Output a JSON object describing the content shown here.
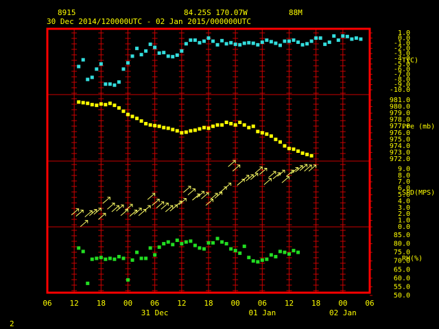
{
  "header": {
    "station_id": "8915",
    "location": "84.25S  170.07W",
    "elevation": "88M",
    "time_range": "30 Dec 2014/120000UTC - 02 Jan 2015/000000UTC"
  },
  "page_number": "2",
  "colors": {
    "frame": "#ff0000",
    "grid": "#cc0000",
    "text": "#ffff00",
    "temperature": "#33dddd",
    "pressure": "#ffff00",
    "wind": "#ffff66",
    "rh": "#22dd22"
  },
  "chart_data": {
    "type": "scatter",
    "title": "",
    "x_axis": {
      "unit": "hours since 30 Dec 2014 06 UTC",
      "range": [
        0,
        72
      ],
      "ticks": [
        0,
        6,
        12,
        18,
        24,
        30,
        36,
        42,
        48,
        54,
        60,
        66,
        72
      ],
      "tick_labels": [
        "06",
        "12",
        "18",
        "00",
        "06",
        "12",
        "18",
        "00",
        "06",
        "12",
        "18",
        "00",
        "06"
      ],
      "day_labels": [
        {
          "x": 24,
          "label": "31 Dec"
        },
        {
          "x": 48,
          "label": "01 Jan"
        },
        {
          "x": 66,
          "label": "02 Jan"
        }
      ]
    },
    "panels": [
      {
        "name": "temperature",
        "label": "T(C)",
        "ylim": [
          -10,
          1
        ],
        "ticks": [
          "1.0",
          "0.0",
          "-1.0",
          "-2.0",
          "-3.0",
          "-4.0",
          "-5.0",
          "-6.0",
          "-7.0",
          "-8.0",
          "-9.0",
          "-10.0"
        ],
        "points": [
          [
            7,
            -5.5
          ],
          [
            8,
            -4.2
          ],
          [
            9,
            -8.0
          ],
          [
            10,
            -7.6
          ],
          [
            11,
            -6.0
          ],
          [
            12,
            -5.0
          ],
          [
            13,
            -8.9
          ],
          [
            14,
            -8.9
          ],
          [
            15,
            -9.1
          ],
          [
            16,
            -8.5
          ],
          [
            17,
            -6.0
          ],
          [
            18,
            -4.8
          ],
          [
            19,
            -3.5
          ],
          [
            20,
            -2.0
          ],
          [
            21,
            -3.2
          ],
          [
            22,
            -2.5
          ],
          [
            23,
            -1.2
          ],
          [
            24,
            -1.8
          ],
          [
            25,
            -2.9
          ],
          [
            26,
            -2.8
          ],
          [
            27,
            -3.5
          ],
          [
            28,
            -3.6
          ],
          [
            29,
            -3.3
          ],
          [
            30,
            -2.5
          ],
          [
            31,
            -1.1
          ],
          [
            32,
            -0.4
          ],
          [
            33,
            -0.4
          ],
          [
            34,
            -0.9
          ],
          [
            35,
            -0.6
          ],
          [
            36,
            0.0
          ],
          [
            37,
            -0.6
          ],
          [
            38,
            -1.3
          ],
          [
            39,
            -0.5
          ],
          [
            40,
            -1.1
          ],
          [
            41,
            -0.9
          ],
          [
            42,
            -1.2
          ],
          [
            43,
            -1.3
          ],
          [
            44,
            -1.0
          ],
          [
            45,
            -0.9
          ],
          [
            46,
            -1.0
          ],
          [
            47,
            -1.3
          ],
          [
            48,
            -0.8
          ],
          [
            49,
            -0.4
          ],
          [
            50,
            -0.7
          ],
          [
            51,
            -1.0
          ],
          [
            52,
            -1.4
          ],
          [
            53,
            -0.6
          ],
          [
            54,
            -0.6
          ],
          [
            55,
            -0.4
          ],
          [
            56,
            -0.8
          ],
          [
            57,
            -1.3
          ],
          [
            58,
            -1.1
          ],
          [
            59,
            -0.6
          ],
          [
            60,
            0.0
          ],
          [
            61,
            0.0
          ],
          [
            62,
            -1.2
          ],
          [
            63,
            -0.8
          ],
          [
            64,
            0.4
          ],
          [
            65,
            -0.4
          ],
          [
            66,
            0.4
          ],
          [
            67,
            0.3
          ],
          [
            68,
            -0.2
          ],
          [
            69,
            0.0
          ],
          [
            70,
            -0.2
          ]
        ]
      },
      {
        "name": "pressure",
        "label": "Pre (mb)",
        "ylim": [
          972,
          981
        ],
        "ticks": [
          "981.0",
          "980.0",
          "979.0",
          "978.0",
          "977.0",
          "976.0",
          "975.0",
          "974.0",
          "973.0",
          "972.0"
        ],
        "points": [
          [
            7,
            980.7
          ],
          [
            8,
            980.6
          ],
          [
            9,
            980.5
          ],
          [
            10,
            980.3
          ],
          [
            11,
            980.2
          ],
          [
            12,
            980.4
          ],
          [
            13,
            980.3
          ],
          [
            14,
            980.5
          ],
          [
            15,
            980.2
          ],
          [
            16,
            979.8
          ],
          [
            17,
            979.3
          ],
          [
            18,
            978.8
          ],
          [
            19,
            978.5
          ],
          [
            20,
            978.2
          ],
          [
            21,
            977.8
          ],
          [
            22,
            977.4
          ],
          [
            23,
            977.2
          ],
          [
            24,
            977.1
          ],
          [
            25,
            977.0
          ],
          [
            26,
            976.8
          ],
          [
            27,
            976.7
          ],
          [
            28,
            976.5
          ],
          [
            29,
            976.3
          ],
          [
            30,
            976.0
          ],
          [
            31,
            976.1
          ],
          [
            32,
            976.3
          ],
          [
            33,
            976.4
          ],
          [
            34,
            976.6
          ],
          [
            35,
            976.8
          ],
          [
            36,
            976.7
          ],
          [
            37,
            977.0
          ],
          [
            38,
            977.2
          ],
          [
            39,
            977.2
          ],
          [
            40,
            977.6
          ],
          [
            41,
            977.4
          ],
          [
            42,
            977.2
          ],
          [
            43,
            977.6
          ],
          [
            44,
            977.2
          ],
          [
            45,
            976.8
          ],
          [
            46,
            977.0
          ],
          [
            47,
            976.2
          ],
          [
            48,
            976.0
          ],
          [
            49,
            975.8
          ],
          [
            50,
            975.5
          ],
          [
            51,
            975.0
          ],
          [
            52,
            974.6
          ],
          [
            53,
            974.0
          ],
          [
            54,
            973.6
          ],
          [
            55,
            973.5
          ],
          [
            56,
            973.2
          ],
          [
            57,
            972.9
          ],
          [
            58,
            972.7
          ],
          [
            59,
            972.5
          ]
        ]
      },
      {
        "name": "wind_speed",
        "label": "SPD(MPS)",
        "ylim": [
          0,
          10
        ],
        "ticks": [
          "9.0",
          "8.0",
          "7.0",
          "6.0",
          "5.0",
          "4.0",
          "3.0",
          "2.0",
          "1.0",
          "0.0"
        ],
        "points": [
          [
            7,
            2.8
          ],
          [
            8,
            2.6
          ],
          [
            9,
            1.0
          ],
          [
            10,
            2.5
          ],
          [
            11,
            2.7
          ],
          [
            12,
            2.9
          ],
          [
            13,
            2.1
          ],
          [
            14,
            4.6
          ],
          [
            15,
            3.7
          ],
          [
            16,
            3.3
          ],
          [
            17,
            3.4
          ],
          [
            18,
            2.7
          ],
          [
            19,
            3.5
          ],
          [
            20,
            2.6
          ],
          [
            21,
            2.9
          ],
          [
            22,
            2.7
          ],
          [
            23,
            3.3
          ],
          [
            24,
            5.2
          ],
          [
            25,
            4.3
          ],
          [
            26,
            3.9
          ],
          [
            27,
            3.7
          ],
          [
            28,
            3.3
          ],
          [
            29,
            3.4
          ],
          [
            30,
            4.0
          ],
          [
            31,
            4.4
          ],
          [
            32,
            6.3
          ],
          [
            33,
            5.9
          ],
          [
            34,
            5.1
          ],
          [
            35,
            5.5
          ],
          [
            36,
            5.3
          ],
          [
            37,
            4.3
          ],
          [
            38,
            5.2
          ],
          [
            39,
            5.4
          ],
          [
            40,
            6.2
          ],
          [
            41,
            6.8
          ],
          [
            42,
            10.3
          ],
          [
            43,
            9.6
          ],
          [
            44,
            7.4
          ],
          [
            45,
            8.0
          ],
          [
            46,
            8.1
          ],
          [
            47,
            8.3
          ],
          [
            48,
            9.3
          ],
          [
            49,
            9.1
          ],
          [
            50,
            7.5
          ],
          [
            51,
            8.6
          ],
          [
            52,
            8.4
          ],
          [
            53,
            8.8
          ],
          [
            54,
            7.8
          ],
          [
            55,
            8.8
          ],
          [
            56,
            9.2
          ],
          [
            57,
            9.5
          ],
          [
            58,
            9.7
          ],
          [
            59,
            9.6
          ],
          [
            60,
            9.6
          ]
        ]
      },
      {
        "name": "relative_humidity",
        "label": "RH(%)",
        "ylim": [
          50,
          85
        ],
        "ticks": [
          "85.0",
          "80.0",
          "75.0",
          "70.0",
          "65.0",
          "60.0",
          "55.0",
          "50.0"
        ],
        "points": [
          [
            7,
            77.5
          ],
          [
            8,
            75.5
          ],
          [
            9,
            57.0
          ],
          [
            10,
            71.0
          ],
          [
            11,
            71.5
          ],
          [
            12,
            72.0
          ],
          [
            13,
            71.0
          ],
          [
            14,
            71.5
          ],
          [
            15,
            71.0
          ],
          [
            16,
            72.5
          ],
          [
            17,
            71.5
          ],
          [
            18,
            59.0
          ],
          [
            19,
            70.5
          ],
          [
            20,
            75.0
          ],
          [
            21,
            71.5
          ],
          [
            22,
            71.5
          ],
          [
            23,
            77.5
          ],
          [
            24,
            73.5
          ],
          [
            25,
            78.0
          ],
          [
            26,
            80.0
          ],
          [
            27,
            81.0
          ],
          [
            28,
            79.5
          ],
          [
            29,
            82.0
          ],
          [
            30,
            80.0
          ],
          [
            31,
            81.0
          ],
          [
            32,
            81.5
          ],
          [
            33,
            79.0
          ],
          [
            34,
            77.5
          ],
          [
            35,
            77.0
          ],
          [
            36,
            80.5
          ],
          [
            37,
            80.5
          ],
          [
            38,
            83.0
          ],
          [
            39,
            81.0
          ],
          [
            40,
            80.0
          ],
          [
            41,
            77.0
          ],
          [
            42,
            76.0
          ],
          [
            43,
            74.5
          ],
          [
            44,
            78.5
          ],
          [
            45,
            72.0
          ],
          [
            46,
            70.0
          ],
          [
            47,
            69.5
          ],
          [
            48,
            70.5
          ],
          [
            49,
            71.0
          ],
          [
            50,
            73.5
          ],
          [
            51,
            72.5
          ],
          [
            52,
            75.5
          ],
          [
            53,
            75.0
          ],
          [
            54,
            74.0
          ],
          [
            55,
            76.0
          ],
          [
            56,
            75.0
          ]
        ]
      }
    ]
  }
}
